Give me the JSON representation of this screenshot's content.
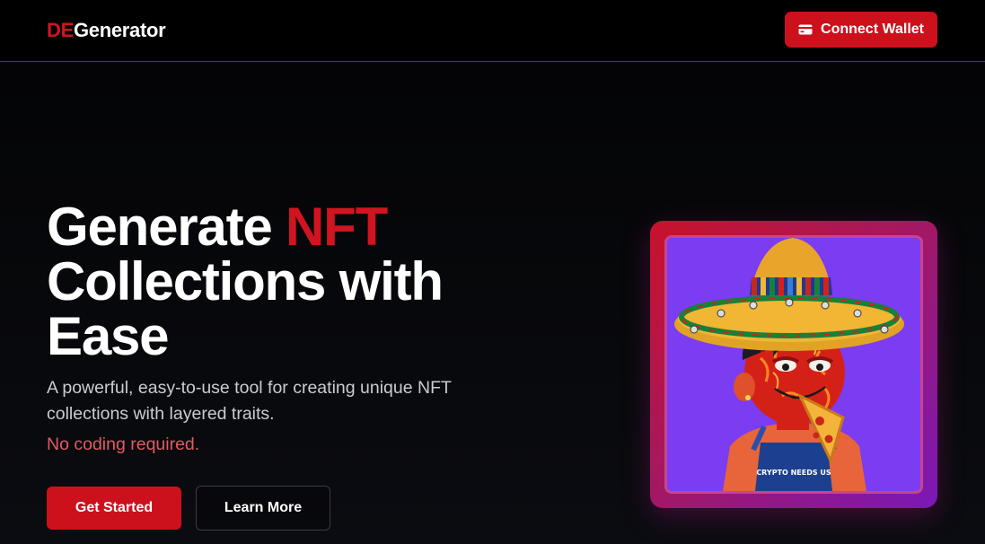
{
  "header": {
    "logo_accent": "DE",
    "logo_rest": "Generator",
    "connect_label": "Connect Wallet",
    "connect_icon": "wallet-icon"
  },
  "hero": {
    "headline_part1": "Generate ",
    "headline_highlight": "NFT",
    "headline_part2": "Collections with Ease",
    "subtitle": "A powerful, easy-to-use tool for creating unique NFT collections with layered traits.",
    "nocode": "No coding required.",
    "primary_button": "Get Started",
    "secondary_button": "Learn More"
  },
  "nft": {
    "shirt_text": "CRYPTO NEEDS US"
  },
  "colors": {
    "accent": "#cc111c",
    "background": "#000000",
    "nocode_text": "#e35a61",
    "nft_background": "#7b3cf2"
  }
}
